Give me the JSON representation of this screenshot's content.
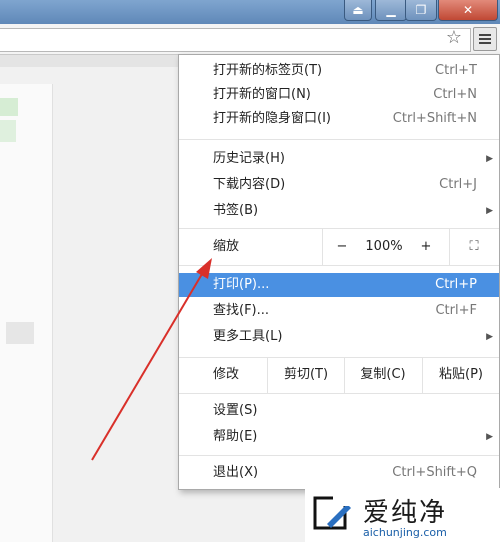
{
  "window": {
    "buttons": {
      "user": "⏏",
      "minimize": "▁",
      "maximize": "❐",
      "close": "✕"
    }
  },
  "toolbar": {
    "star_icon": "star-icon",
    "menu_icon": "hamburger-menu-icon"
  },
  "menu": {
    "new_tab": {
      "label": "打开新的标签页(T)",
      "shortcut": "Ctrl+T"
    },
    "new_window": {
      "label": "打开新的窗口(N)",
      "shortcut": "Ctrl+N"
    },
    "new_incognito": {
      "label": "打开新的隐身窗口(I)",
      "shortcut": "Ctrl+Shift+N"
    },
    "history": {
      "label": "历史记录(H)"
    },
    "downloads": {
      "label": "下载内容(D)",
      "shortcut": "Ctrl+J"
    },
    "bookmarks": {
      "label": "书签(B)"
    },
    "zoom": {
      "label": "缩放",
      "minus": "−",
      "value": "100%",
      "plus": "+",
      "fullscreen": "⛶"
    },
    "print": {
      "label": "打印(P)...",
      "shortcut": "Ctrl+P"
    },
    "find": {
      "label": "查找(F)...",
      "shortcut": "Ctrl+F"
    },
    "more_tools": {
      "label": "更多工具(L)"
    },
    "edit": {
      "label": "修改",
      "cut": "剪切(T)",
      "copy": "复制(C)",
      "paste": "粘贴(P)"
    },
    "settings": {
      "label": "设置(S)"
    },
    "help": {
      "label": "帮助(E)"
    },
    "exit": {
      "label": "退出(X)",
      "shortcut": "Ctrl+Shift+Q"
    }
  },
  "watermark": {
    "text": "爱纯净",
    "url": "aichunjing.com"
  },
  "colors": {
    "highlight": "#4a90e2",
    "annotation_arrow": "#d9302a"
  }
}
